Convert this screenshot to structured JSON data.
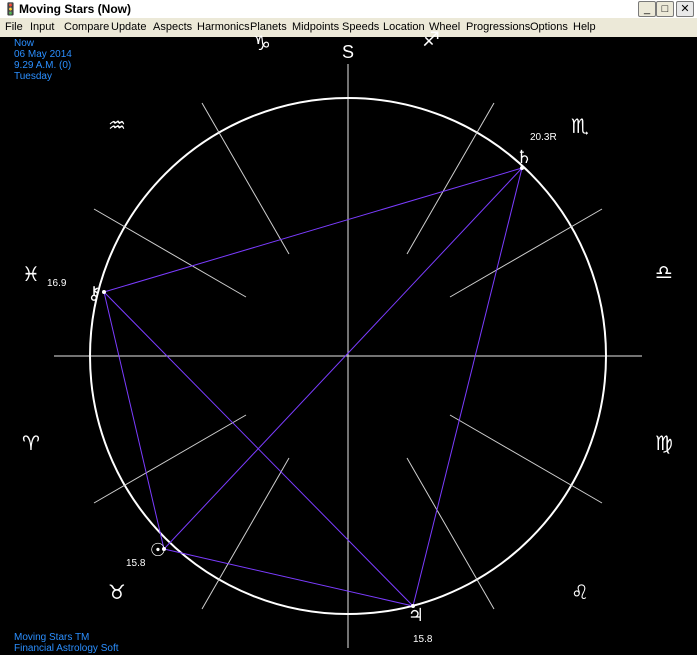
{
  "window": {
    "title": "Moving Stars (Now)",
    "app_icon": "traffic-light-icon",
    "minimize_label": "_",
    "maximize_label": "□",
    "close_label": "✕"
  },
  "menu": [
    {
      "label": "File"
    },
    {
      "label": "Input"
    },
    {
      "label": "Compare"
    },
    {
      "label": "Update"
    },
    {
      "label": "Aspects"
    },
    {
      "label": "Harmonics"
    },
    {
      "label": "Planets"
    },
    {
      "label": "Midpoints"
    },
    {
      "label": "Speeds"
    },
    {
      "label": "Location"
    },
    {
      "label": "Wheel"
    },
    {
      "label": "Progressions"
    },
    {
      "label": "Options"
    },
    {
      "label": "Help"
    }
  ],
  "info": {
    "line1": "Now",
    "line2": "06 May 2014",
    "line3": "9.29 A.M. (0)",
    "line4": "Tuesday"
  },
  "footer": {
    "line1": "Moving Stars TM",
    "line2": "Financial Astrology Soft"
  },
  "wheel": {
    "south_label": "S",
    "signs": [
      {
        "name": "capricorn",
        "glyph": "♑"
      },
      {
        "name": "sagittarius",
        "glyph": "♐"
      },
      {
        "name": "aquarius",
        "glyph": "♒"
      },
      {
        "name": "scorpio",
        "glyph": "♏"
      },
      {
        "name": "pisces",
        "glyph": "♓"
      },
      {
        "name": "libra",
        "glyph": "♎"
      },
      {
        "name": "aries",
        "glyph": "♈"
      },
      {
        "name": "virgo",
        "glyph": "♍"
      },
      {
        "name": "taurus",
        "glyph": "♉"
      },
      {
        "name": "leo",
        "glyph": "♌"
      }
    ],
    "planets": [
      {
        "name": "saturn",
        "glyph": "♄",
        "degree": "20.3R"
      },
      {
        "name": "chiron",
        "glyph": "⚷",
        "degree": "16.9"
      },
      {
        "name": "sun",
        "glyph": "☉",
        "degree": "15.8"
      },
      {
        "name": "jupiter",
        "glyph": "♃",
        "degree": "15.8"
      }
    ],
    "colors": {
      "ring": "#ffffff",
      "spokes": "#cfcfcf",
      "aspects": "#7b3cff",
      "labels": "#ffffff",
      "info_text": "#2b8fff"
    }
  }
}
